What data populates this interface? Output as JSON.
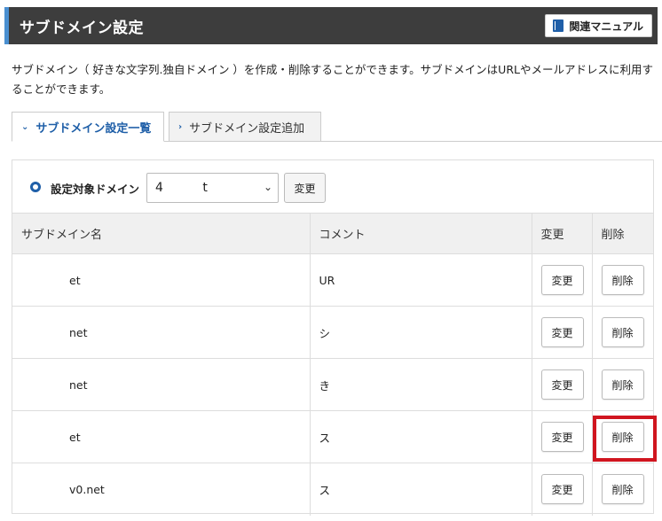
{
  "header": {
    "title": "サブドメイン設定",
    "manual_label": "関連マニュアル"
  },
  "description": "サブドメイン（ 好きな文字列.独自ドメイン ）を作成・削除することができます。サブドメインはURLやメールアドレスに利用することができます。",
  "tabs": [
    {
      "label": "サブドメイン設定一覧",
      "active": true
    },
    {
      "label": "サブドメイン設定追加",
      "active": false
    }
  ],
  "domain_selector": {
    "label": "設定対象ドメイン",
    "value": "4          t",
    "change_label": "変更"
  },
  "table": {
    "headers": [
      "サブドメイン名",
      "コメント",
      "変更",
      "削除"
    ],
    "rows": [
      {
        "name": "et",
        "comment": "UR",
        "change": "変更",
        "delete": "削除"
      },
      {
        "name": "net",
        "comment": "シ",
        "change": "変更",
        "delete": "削除"
      },
      {
        "name": "net",
        "comment": "き",
        "change": "変更",
        "delete": "削除"
      },
      {
        "name": "et",
        "comment": "ス",
        "change": "変更",
        "delete": "削除"
      },
      {
        "name": "v0.net",
        "comment": "ス",
        "change": "変更",
        "delete": "削除"
      }
    ]
  },
  "colors": {
    "header_bg": "#3d3d3d",
    "accent": "#1f5fa8",
    "highlight": "#d0151f"
  }
}
